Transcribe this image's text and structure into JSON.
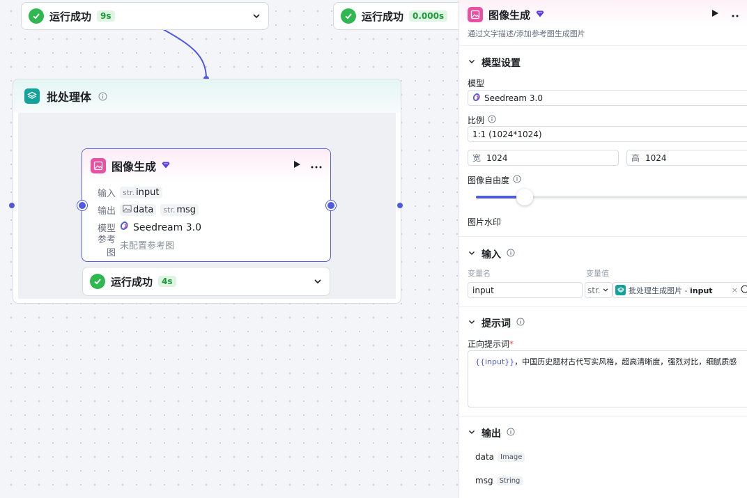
{
  "top_status_left": {
    "label": "运行成功",
    "time": "9s"
  },
  "top_status_right": {
    "label": "运行成功",
    "time": "0.000s"
  },
  "batch": {
    "title": "批处理体"
  },
  "image_node": {
    "title": "图像生成",
    "input_label": "输入",
    "input_type": "str.",
    "input_value": "input",
    "output_label": "输出",
    "output_data": "data",
    "output_msg_type": "str.",
    "output_msg": "msg",
    "model_label": "模型",
    "model_value": "Seedream 3.0",
    "ref_label": "参考图",
    "ref_value": "未配置参考图"
  },
  "inner_status": {
    "label": "运行成功",
    "time": "4s"
  },
  "panel": {
    "title": "图像生成",
    "subtitle": "通过文字描述/添加参考图生成图片",
    "model_settings": {
      "title": "模型设置",
      "model_label": "模型",
      "model_value": "Seedream 3.0",
      "ratio_label": "比例",
      "ratio_value": "1:1 (1024*1024)",
      "width_label": "宽",
      "width_value": "1024",
      "height_label": "高",
      "height_value": "1024",
      "freedom_label": "图像自由度",
      "freedom_level_percent": 18,
      "watermark_label": "图片水印"
    },
    "input_section": {
      "title": "输入",
      "col_name": "变量名",
      "col_value": "变量值",
      "var_name": "input",
      "var_type": "str.",
      "var_ref_source": "批处理生成图片",
      "var_ref_sep": " - ",
      "var_ref_field": "input"
    },
    "prompt_section": {
      "title": "提示词",
      "positive_label": "正向提示词",
      "required_mark": "*",
      "var_token": "{{input}}",
      "prompt_text": "，中国历史题材古代写实风格，超高清晰度，强烈对比，细腻质感"
    },
    "output_section": {
      "title": "输出",
      "items": [
        {
          "name": "data",
          "type": "Image"
        },
        {
          "name": "msg",
          "type": "String"
        }
      ]
    }
  },
  "colors": {
    "accent": "#4e5ae0",
    "success": "#2fb84f",
    "teal": "#14a39a",
    "pink": "#e94fa3"
  }
}
